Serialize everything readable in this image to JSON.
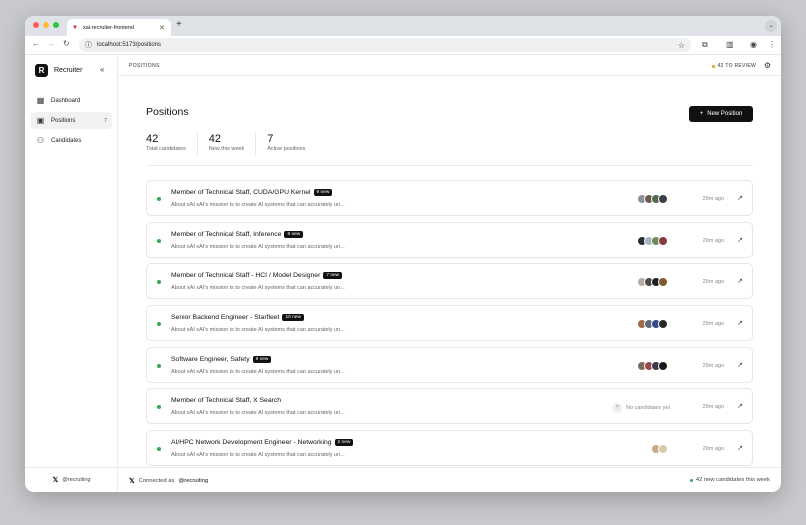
{
  "colors": {
    "accent": "#111111",
    "live": "#3aa55b",
    "review_dot": "#e3a21a"
  },
  "browser": {
    "tab_title": "xai-recruiter-frontend",
    "url": "localhost:5173/positions"
  },
  "sidebar": {
    "brand": "Recruiter",
    "logo_letter": "R",
    "items": [
      {
        "label": "Dashboard",
        "icon": "grid-icon"
      },
      {
        "label": "Positions",
        "icon": "briefcase-icon",
        "count": "7"
      },
      {
        "label": "Candidates",
        "icon": "users-icon"
      }
    ],
    "footer_handle": "@recruiting"
  },
  "header": {
    "breadcrumb": "POSITIONS",
    "review": "42 TO REVIEW"
  },
  "main": {
    "title": "Positions",
    "new_button": "New Position",
    "stats": [
      {
        "value": "42",
        "label": "Total candidates"
      },
      {
        "value": "42",
        "label": "New this week"
      },
      {
        "value": "7",
        "label": "Active positions"
      }
    ],
    "positions": [
      {
        "title": "Member of Technical Staff, CUDA/GPU Kernel",
        "badge": "9 new",
        "desc": "About xAI xAI's mission is to create AI systems that can accurately un...",
        "time": "29m ago",
        "avatars": [
          "#8a8f99",
          "#6b5b4f",
          "#4f6b52",
          "#3d3d4a"
        ]
      },
      {
        "title": "Member of Technical Staff, Inference",
        "badge": "6 new",
        "desc": "About xAI xAI's mission is to create AI systems that can accurately un...",
        "time": "29m ago",
        "avatars": [
          "#2b2f3a",
          "#a8b4c0",
          "#6f8a5e",
          "#8b3a3a"
        ]
      },
      {
        "title": "Member of Technical Staff - HCI / Model Designer",
        "badge": "7 new",
        "desc": "About xAI xAI's mission is to create AI systems that can accurately un...",
        "time": "29m ago",
        "avatars": [
          "#b9a9a0",
          "#4a4a4a",
          "#1f1f1f",
          "#7a5a2e"
        ]
      },
      {
        "title": "Senior Backend Engineer - Starfleet",
        "badge": "10 new",
        "desc": "About xAI xAI's mission is to create AI systems that can accurately un...",
        "time": "29m ago",
        "avatars": [
          "#a06a4a",
          "#5a6a7a",
          "#3a4a8a",
          "#2a2a2a"
        ]
      },
      {
        "title": "Software Engineer, Safety",
        "badge": "8 new",
        "desc": "About xAI xAI's mission is to create AI systems that can accurately un...",
        "time": "29m ago",
        "avatars": [
          "#7a6a5a",
          "#9a4a4a",
          "#3a3a4a",
          "#1a1a1a"
        ]
      },
      {
        "title": "Member of Technical Staff, X Search",
        "badge": "",
        "desc": "About xAI xAI's mission is to create AI systems that can accurately un...",
        "time": "29m ago",
        "avatars": [],
        "empty_text": "No candidates yet",
        "empty_mark": "?"
      },
      {
        "title": "AI/HPC Network Development Engineer - Networking",
        "badge": "2 new",
        "desc": "About xAI xAI's mission is to create AI systems that can accurately un...",
        "time": "29m ago",
        "avatars": [
          "#c9a98a",
          "#d8c9a8"
        ]
      }
    ]
  },
  "footer": {
    "connected_prefix": "Connected as",
    "handle": "@recruiting",
    "weekly": "42 new candidates this week"
  }
}
